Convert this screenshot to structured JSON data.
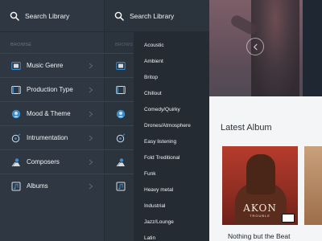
{
  "search": {
    "label": "Search Library"
  },
  "sidebar": {
    "browse_label": "BROWSE",
    "browse_label_clipped": "BROWS",
    "items": [
      {
        "label": "Music Genre",
        "icon": "music-genre-icon"
      },
      {
        "label": "Production Type",
        "icon": "production-type-icon"
      },
      {
        "label": "Mood & Theme",
        "icon": "mood-theme-icon"
      },
      {
        "label": "Intrumentation",
        "icon": "instrumentation-icon"
      },
      {
        "label": "Composers",
        "icon": "composers-icon"
      },
      {
        "label": "Albums",
        "icon": "albums-icon"
      }
    ]
  },
  "genre_menu": {
    "items": [
      "Acoustic",
      "Ambient",
      "Britop",
      "Chillout",
      "Comedy/Quirky",
      "Drones/Atmosphere",
      "Easy listening",
      "Fold Treditional",
      "Funk",
      "Heavy metal",
      "Industrial",
      "Jazz/Lounge",
      "Latin"
    ]
  },
  "content": {
    "section_title": "Latest Album",
    "album": {
      "caption": "Nothing but the Beat",
      "cover_text": "AKON",
      "cover_subtext": "TROUBLE"
    }
  },
  "colors": {
    "panel": "#2f3842",
    "menu": "#242b33",
    "accent": "#3a8fd0",
    "content_bg": "#f4f5f6"
  }
}
